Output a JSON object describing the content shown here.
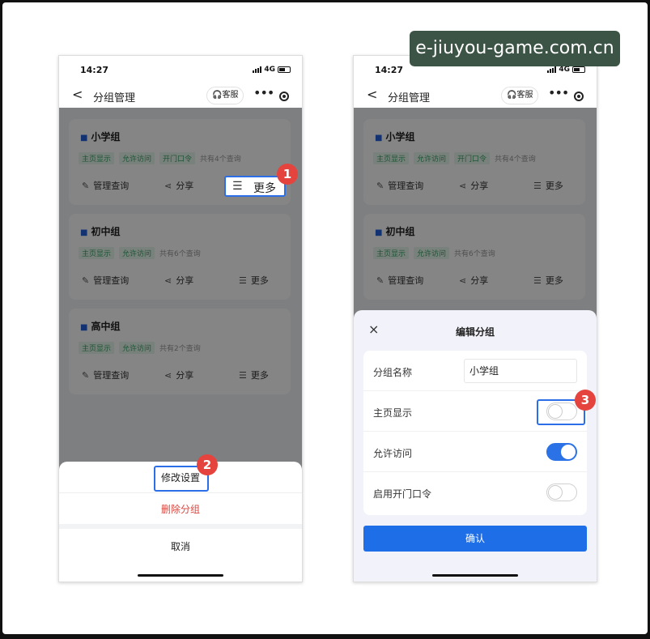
{
  "watermark": "e-jiuyou-game.com.cn",
  "status": {
    "time": "14:27",
    "network": "4G"
  },
  "nav": {
    "back": "<",
    "title": "分组管理",
    "service": "客服",
    "more": "•••"
  },
  "groups": [
    {
      "name": "小学组",
      "tags": [
        "主页显示",
        "允许访问",
        "开门口令"
      ],
      "count": "共有4个查询"
    },
    {
      "name": "初中组",
      "tags": [
        "主页显示",
        "允许访问"
      ],
      "count": "共有6个查询"
    },
    {
      "name": "高中组",
      "tags": [
        "主页显示",
        "允许访问"
      ],
      "count": "共有2个查询"
    }
  ],
  "actions": {
    "manage": "管理查询",
    "share": "分享",
    "more": "更多"
  },
  "action_sheet": {
    "modify": "修改设置",
    "delete": "删除分组",
    "cancel": "取消",
    "delete_color": "#d9473f"
  },
  "modal": {
    "title": "编辑分组",
    "close": "×",
    "fields": [
      {
        "label": "分组名称",
        "value": "小学组"
      },
      {
        "label": "主页显示",
        "on": false
      },
      {
        "label": "允许访问",
        "on": true
      },
      {
        "label": "启用开门口令",
        "on": false
      }
    ],
    "confirm": "确认"
  },
  "badges": [
    "1",
    "2",
    "3"
  ],
  "colors": {
    "accent": "#1e6ee8",
    "badge": "#e5443e",
    "tag_bg": "#e8f7ee",
    "tag_text": "#3aa064"
  }
}
